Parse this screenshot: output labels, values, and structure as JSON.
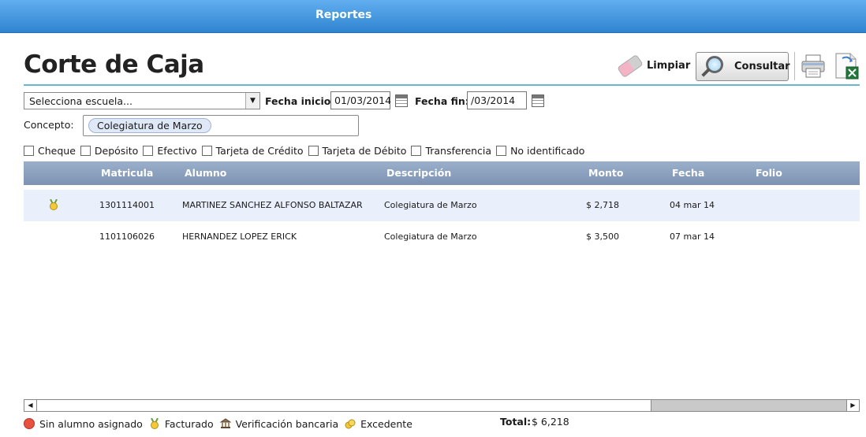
{
  "header": {
    "title": "Reportes"
  },
  "page": {
    "title": "Corte de Caja"
  },
  "toolbar": {
    "limpiar_label": "Limpiar",
    "consultar_label": "Consultar",
    "print_icon": "printer-icon",
    "export_icon": "excel-export-icon"
  },
  "filters": {
    "school_select_value": "Selecciona escuela...",
    "fecha_inicio_label": "Fecha inicio:",
    "fecha_inicio_value": "01/03/2014",
    "fecha_fin_label": "Fecha fin:",
    "fecha_fin_value": "/03/2014",
    "concepto_label": "Concepto:",
    "concepto_chip": "Colegiatura de Marzo"
  },
  "payment_types": [
    {
      "label": "Cheque",
      "checked": false
    },
    {
      "label": "Depósito",
      "checked": false
    },
    {
      "label": "Efectivo",
      "checked": false
    },
    {
      "label": "Tarjeta de Crédito",
      "checked": false
    },
    {
      "label": "Tarjeta de Débito",
      "checked": false
    },
    {
      "label": "Transferencia",
      "checked": false
    },
    {
      "label": "No identificado",
      "checked": false
    }
  ],
  "table": {
    "columns": [
      "Matricula",
      "Alumno",
      "Descripción",
      "Monto",
      "Fecha",
      "Folio"
    ],
    "rows": [
      {
        "status_icon": "facturado-icon",
        "matricula": "1301114001",
        "alumno": "MARTINEZ SANCHEZ ALFONSO BALTAZAR",
        "descripcion": "Colegiatura de Marzo",
        "monto": "$ 2,718",
        "fecha": "04 mar 14",
        "folio": ""
      },
      {
        "status_icon": "",
        "matricula": "1101106026",
        "alumno": "HERNANDEZ LOPEZ ERICK",
        "descripcion": "Colegiatura de Marzo",
        "monto": "$ 3,500",
        "fecha": "07 mar 14",
        "folio": ""
      }
    ]
  },
  "legend": [
    {
      "label": "Sin alumno asignado",
      "icon": "red-dot-icon"
    },
    {
      "label": "Facturado",
      "icon": "medal-icon"
    },
    {
      "label": "Verificación bancaria",
      "icon": "bank-icon"
    },
    {
      "label": "Excedente",
      "icon": "coins-icon"
    }
  ],
  "totals": {
    "label": "Total:",
    "value": "$ 6,218"
  },
  "colors": {
    "header_blue": "#2f84cf",
    "grid_header": "#8aa0bd",
    "row_alt": "#e9f0fb",
    "accent_rule": "#6ab5cf"
  }
}
